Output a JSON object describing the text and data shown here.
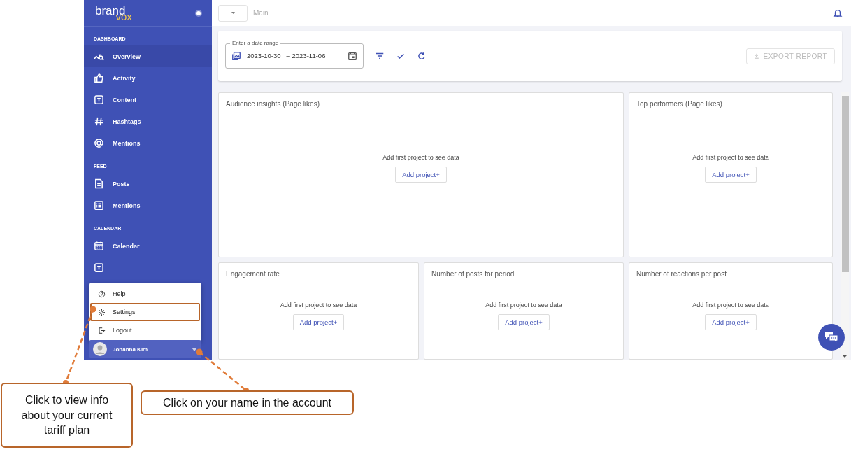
{
  "sidebar": {
    "logo": {
      "brand": "brand",
      "accent": "vox"
    },
    "sections": [
      {
        "title": "DASHBOARD",
        "items": [
          {
            "label": "Overview",
            "selected": true
          },
          {
            "label": "Activity",
            "selected": false
          },
          {
            "label": "Content",
            "selected": false
          },
          {
            "label": "Hashtags",
            "selected": false
          },
          {
            "label": "Mentions",
            "selected": false
          }
        ]
      },
      {
        "title": "FEED",
        "items": [
          {
            "label": "Posts",
            "selected": false
          },
          {
            "label": "Mentions",
            "selected": false
          }
        ]
      },
      {
        "title": "CALENDAR",
        "items": [
          {
            "label": "Calendar",
            "selected": false
          }
        ]
      }
    ],
    "user_menu": [
      {
        "label": "Help",
        "highlighted": false
      },
      {
        "label": "Settings",
        "highlighted": true
      },
      {
        "label": "Logout",
        "highlighted": false
      }
    ],
    "user": {
      "name": "Johanna Kim"
    }
  },
  "topbar": {
    "breadcrumb": "Main"
  },
  "toolbar": {
    "date_range": {
      "label": "Enter a date range",
      "start": "2023-10-30",
      "separator": "–",
      "end": "2023-11-06"
    },
    "export": {
      "label": "EXPORT REPORT",
      "disabled": true
    }
  },
  "cards": [
    {
      "title": "Audience insights (Page likes)",
      "message": "Add first project to see data",
      "button": "Add project+"
    },
    {
      "title": "Top performers (Page likes)",
      "message": "Add first project to see data",
      "button": "Add project+"
    },
    {
      "title": "Engagement rate",
      "message": "Add first project to see data",
      "button": "Add project+"
    },
    {
      "title": "Number of posts for period",
      "message": "Add first project to see data",
      "button": "Add project+"
    },
    {
      "title": "Number of reactions per post",
      "message": "Add first project to see data",
      "button": "Add project+"
    }
  ],
  "callouts": [
    {
      "text": "Click to view info about your current tariff plan"
    },
    {
      "text": "Click on your name in the account"
    }
  ]
}
